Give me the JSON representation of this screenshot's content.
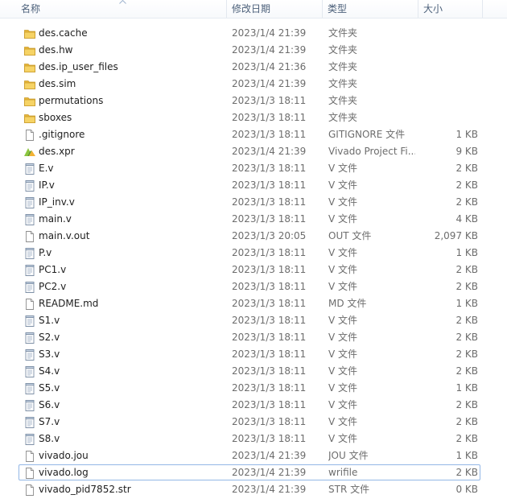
{
  "columns": {
    "name": "名称",
    "date": "修改日期",
    "type": "类型",
    "size": "大小"
  },
  "files": [
    {
      "name": "des.cache",
      "date": "2023/1/4 21:39",
      "type": "文件夹",
      "size": "",
      "icon": "folder-icon"
    },
    {
      "name": "des.hw",
      "date": "2023/1/4 21:39",
      "type": "文件夹",
      "size": "",
      "icon": "folder-icon"
    },
    {
      "name": "des.ip_user_files",
      "date": "2023/1/4 21:36",
      "type": "文件夹",
      "size": "",
      "icon": "folder-icon"
    },
    {
      "name": "des.sim",
      "date": "2023/1/4 21:39",
      "type": "文件夹",
      "size": "",
      "icon": "folder-icon"
    },
    {
      "name": "permutations",
      "date": "2023/1/3 18:11",
      "type": "文件夹",
      "size": "",
      "icon": "folder-icon"
    },
    {
      "name": "sboxes",
      "date": "2023/1/3 18:11",
      "type": "文件夹",
      "size": "",
      "icon": "folder-icon"
    },
    {
      "name": ".gitignore",
      "date": "2023/1/3 18:11",
      "type": "GITIGNORE 文件",
      "size": "1 KB",
      "icon": "blank-file-icon"
    },
    {
      "name": "des.xpr",
      "date": "2023/1/4 21:39",
      "type": "Vivado Project Fi...",
      "size": "9 KB",
      "icon": "vivado-project-icon"
    },
    {
      "name": "E.v",
      "date": "2023/1/3 18:11",
      "type": "V 文件",
      "size": "2 KB",
      "icon": "text-file-icon"
    },
    {
      "name": "IP.v",
      "date": "2023/1/3 18:11",
      "type": "V 文件",
      "size": "2 KB",
      "icon": "text-file-icon"
    },
    {
      "name": "IP_inv.v",
      "date": "2023/1/3 18:11",
      "type": "V 文件",
      "size": "2 KB",
      "icon": "text-file-icon"
    },
    {
      "name": "main.v",
      "date": "2023/1/3 18:11",
      "type": "V 文件",
      "size": "4 KB",
      "icon": "text-file-icon"
    },
    {
      "name": "main.v.out",
      "date": "2023/1/3 20:05",
      "type": "OUT 文件",
      "size": "2,097 KB",
      "icon": "blank-file-icon"
    },
    {
      "name": "P.v",
      "date": "2023/1/3 18:11",
      "type": "V 文件",
      "size": "1 KB",
      "icon": "text-file-icon"
    },
    {
      "name": "PC1.v",
      "date": "2023/1/3 18:11",
      "type": "V 文件",
      "size": "2 KB",
      "icon": "text-file-icon"
    },
    {
      "name": "PC2.v",
      "date": "2023/1/3 18:11",
      "type": "V 文件",
      "size": "2 KB",
      "icon": "text-file-icon"
    },
    {
      "name": "README.md",
      "date": "2023/1/3 18:11",
      "type": "MD 文件",
      "size": "1 KB",
      "icon": "blank-file-icon"
    },
    {
      "name": "S1.v",
      "date": "2023/1/3 18:11",
      "type": "V 文件",
      "size": "2 KB",
      "icon": "text-file-icon"
    },
    {
      "name": "S2.v",
      "date": "2023/1/3 18:11",
      "type": "V 文件",
      "size": "2 KB",
      "icon": "text-file-icon"
    },
    {
      "name": "S3.v",
      "date": "2023/1/3 18:11",
      "type": "V 文件",
      "size": "2 KB",
      "icon": "text-file-icon"
    },
    {
      "name": "S4.v",
      "date": "2023/1/3 18:11",
      "type": "V 文件",
      "size": "2 KB",
      "icon": "text-file-icon"
    },
    {
      "name": "S5.v",
      "date": "2023/1/3 18:11",
      "type": "V 文件",
      "size": "1 KB",
      "icon": "text-file-icon"
    },
    {
      "name": "S6.v",
      "date": "2023/1/3 18:11",
      "type": "V 文件",
      "size": "2 KB",
      "icon": "text-file-icon"
    },
    {
      "name": "S7.v",
      "date": "2023/1/3 18:11",
      "type": "V 文件",
      "size": "2 KB",
      "icon": "text-file-icon"
    },
    {
      "name": "S8.v",
      "date": "2023/1/3 18:11",
      "type": "V 文件",
      "size": "2 KB",
      "icon": "text-file-icon"
    },
    {
      "name": "vivado.jou",
      "date": "2023/1/4 21:39",
      "type": "JOU 文件",
      "size": "1 KB",
      "icon": "blank-file-icon"
    },
    {
      "name": "vivado.log",
      "date": "2023/1/4 21:39",
      "type": "wrifile",
      "size": "2 KB",
      "icon": "blank-file-icon",
      "selected": true
    },
    {
      "name": "vivado_pid7852.str",
      "date": "2023/1/4 21:39",
      "type": "STR 文件",
      "size": "0 KB",
      "icon": "blank-file-icon"
    }
  ],
  "colors": {
    "folder": "#f2c94c",
    "selection_border": "#93b7e6",
    "header_text": "#4c607a",
    "vivado_green": "#8cc63f"
  }
}
